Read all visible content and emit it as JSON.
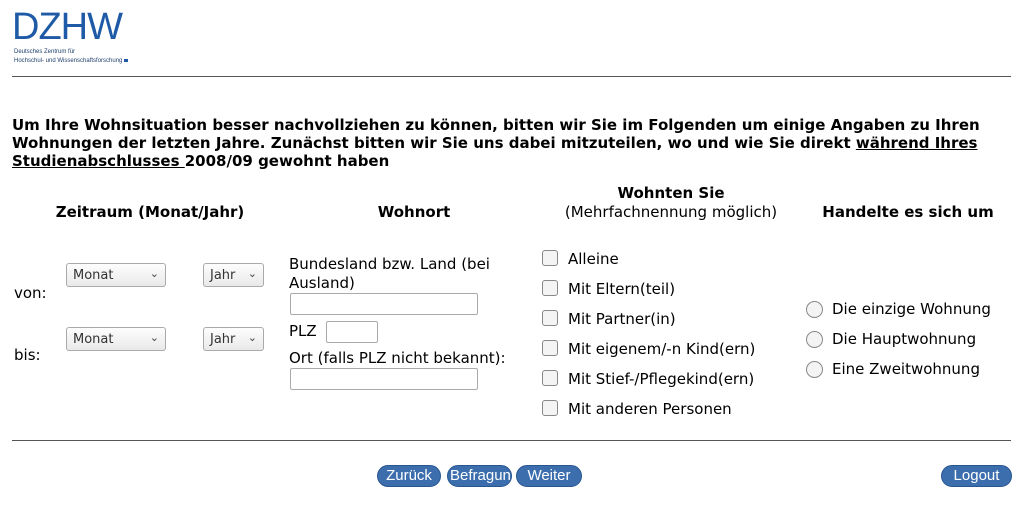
{
  "logo": {
    "wordmark": "DZHW",
    "line1": "Deutsches Zentrum für",
    "line2": "Hochschul- und Wissenschaftsforschung"
  },
  "question": {
    "part1": "Um Ihre Wohnsituation besser nachvollziehen zu können, bitten wir Sie im Folgenden um einige Angaben zu Ihren Wohnungen der letzten Jahre. Zunächst bitten wir Sie uns dabei mitzuteilen, wo und wie Sie direkt ",
    "underlined": "während Ihres Studienabschlusses ",
    "part2": "2008/09 gewohnt haben"
  },
  "columns": {
    "zeitraum": "Zeitraum (Monat/Jahr)",
    "wohnort": "Wohnort",
    "wohnten": "Wohnten Sie",
    "wohnten_sub": "(Mehrfachnennung möglich)",
    "handelte": "Handelte es sich um"
  },
  "zeitraum": {
    "von_label": "von:",
    "bis_label": "bis:",
    "monat": "Monat",
    "jahr": "Jahr"
  },
  "wohnort": {
    "bundesland_label": "Bundesland bzw. Land (bei Ausland)",
    "plz_label": "PLZ",
    "ort_label": "Ort (falls PLZ nicht bekannt):",
    "bundesland_value": "",
    "plz_value": "",
    "ort_value": ""
  },
  "wohnten_options": [
    "Alleine",
    "Mit Eltern(teil)",
    "Mit Partner(in)",
    "Mit eigenem/-n Kind(ern)",
    "Mit Stief-/Pflegekind(ern)",
    "Mit anderen Personen"
  ],
  "handelte_options": [
    "Die einzige Wohnung",
    "Die Hauptwohnung",
    "Eine Zweitwohnung"
  ],
  "buttons": {
    "zurueck": "Zurück",
    "befragung": "Befragung",
    "weiter": "Weiter",
    "logout": "Logout"
  },
  "colors": {
    "brand": "#1f5aa6",
    "button": "#3c6eae"
  }
}
